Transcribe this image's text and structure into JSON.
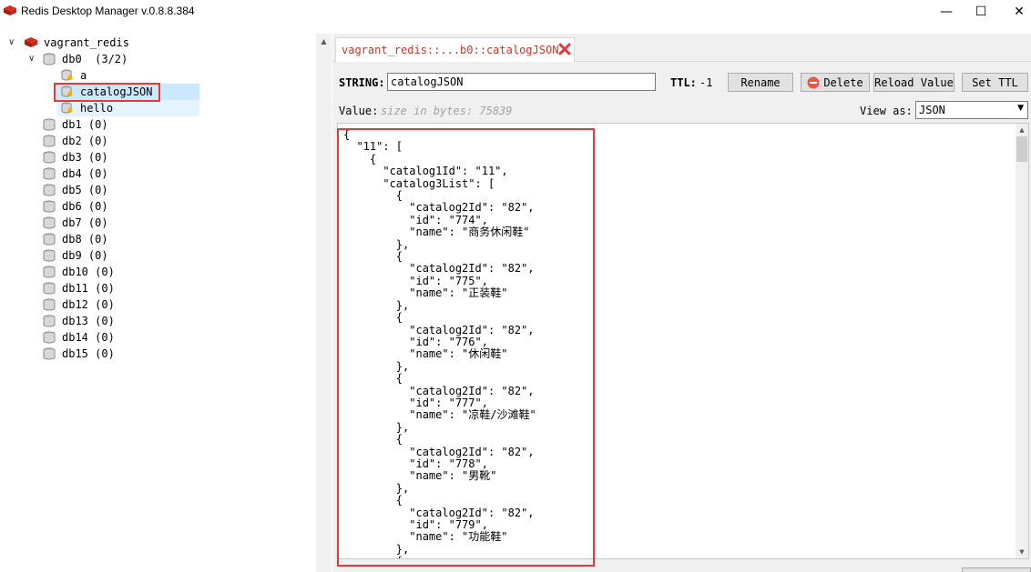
{
  "window": {
    "title": "Redis Desktop Manager v.0.8.8.384",
    "minimize_glyph": "—",
    "maximize_glyph": "☐",
    "close_glyph": "✕"
  },
  "tree": {
    "connection": {
      "label": "vagrant_redis",
      "icon": "redis-server-icon"
    },
    "open_db": {
      "label": "db0  (3/2)",
      "keys": [
        {
          "label": "a",
          "icon": "key-icon"
        },
        {
          "label": "catalogJSON",
          "icon": "key-icon",
          "selected": true
        },
        {
          "label": "hello",
          "icon": "key-icon"
        }
      ]
    },
    "databases": [
      "db1 (0)",
      "db2 (0)",
      "db3 (0)",
      "db4 (0)",
      "db5 (0)",
      "db6 (0)",
      "db7 (0)",
      "db8 (0)",
      "db9 (0)",
      "db10 (0)",
      "db11 (0)",
      "db12 (0)",
      "db13 (0)",
      "db14 (0)",
      "db15 (0)"
    ]
  },
  "tab": {
    "label": "vagrant_redis::...b0::catalogJSON"
  },
  "key_view": {
    "type_label": "STRING:",
    "key_name": "catalogJSON",
    "ttl_label": "TTL:",
    "ttl_value": "-1",
    "rename_label": "Rename",
    "delete_label": "Delete",
    "reload_label": "Reload Value",
    "set_ttl_label": "Set TTL",
    "value_label": "Value:",
    "size_text": "size in bytes: 75839",
    "view_as_label": "View as:",
    "view_as_value": "JSON"
  },
  "value_lines": [
    "{",
    "  \"11\": [",
    "    {",
    "      \"catalog1Id\": \"11\",",
    "      \"catalog3List\": [",
    "        {",
    "          \"catalog2Id\": \"82\",",
    "          \"id\": \"774\",",
    "          \"name\": \"商务休闲鞋\"",
    "        },",
    "        {",
    "          \"catalog2Id\": \"82\",",
    "          \"id\": \"775\",",
    "          \"name\": \"正装鞋\"",
    "        },",
    "        {",
    "          \"catalog2Id\": \"82\",",
    "          \"id\": \"776\",",
    "          \"name\": \"休闲鞋\"",
    "        },",
    "        {",
    "          \"catalog2Id\": \"82\",",
    "          \"id\": \"777\",",
    "          \"name\": \"凉鞋/沙滩鞋\"",
    "        },",
    "        {",
    "          \"catalog2Id\": \"82\",",
    "          \"id\": \"778\",",
    "          \"name\": \"男靴\"",
    "        },",
    "        {",
    "          \"catalog2Id\": \"82\",",
    "          \"id\": \"779\",",
    "          \"name\": \"功能鞋\"",
    "        },",
    "        {"
  ],
  "colors": {
    "highlight": "#e53935",
    "selection": "#cce8ff",
    "tab_text": "#c0392b"
  }
}
